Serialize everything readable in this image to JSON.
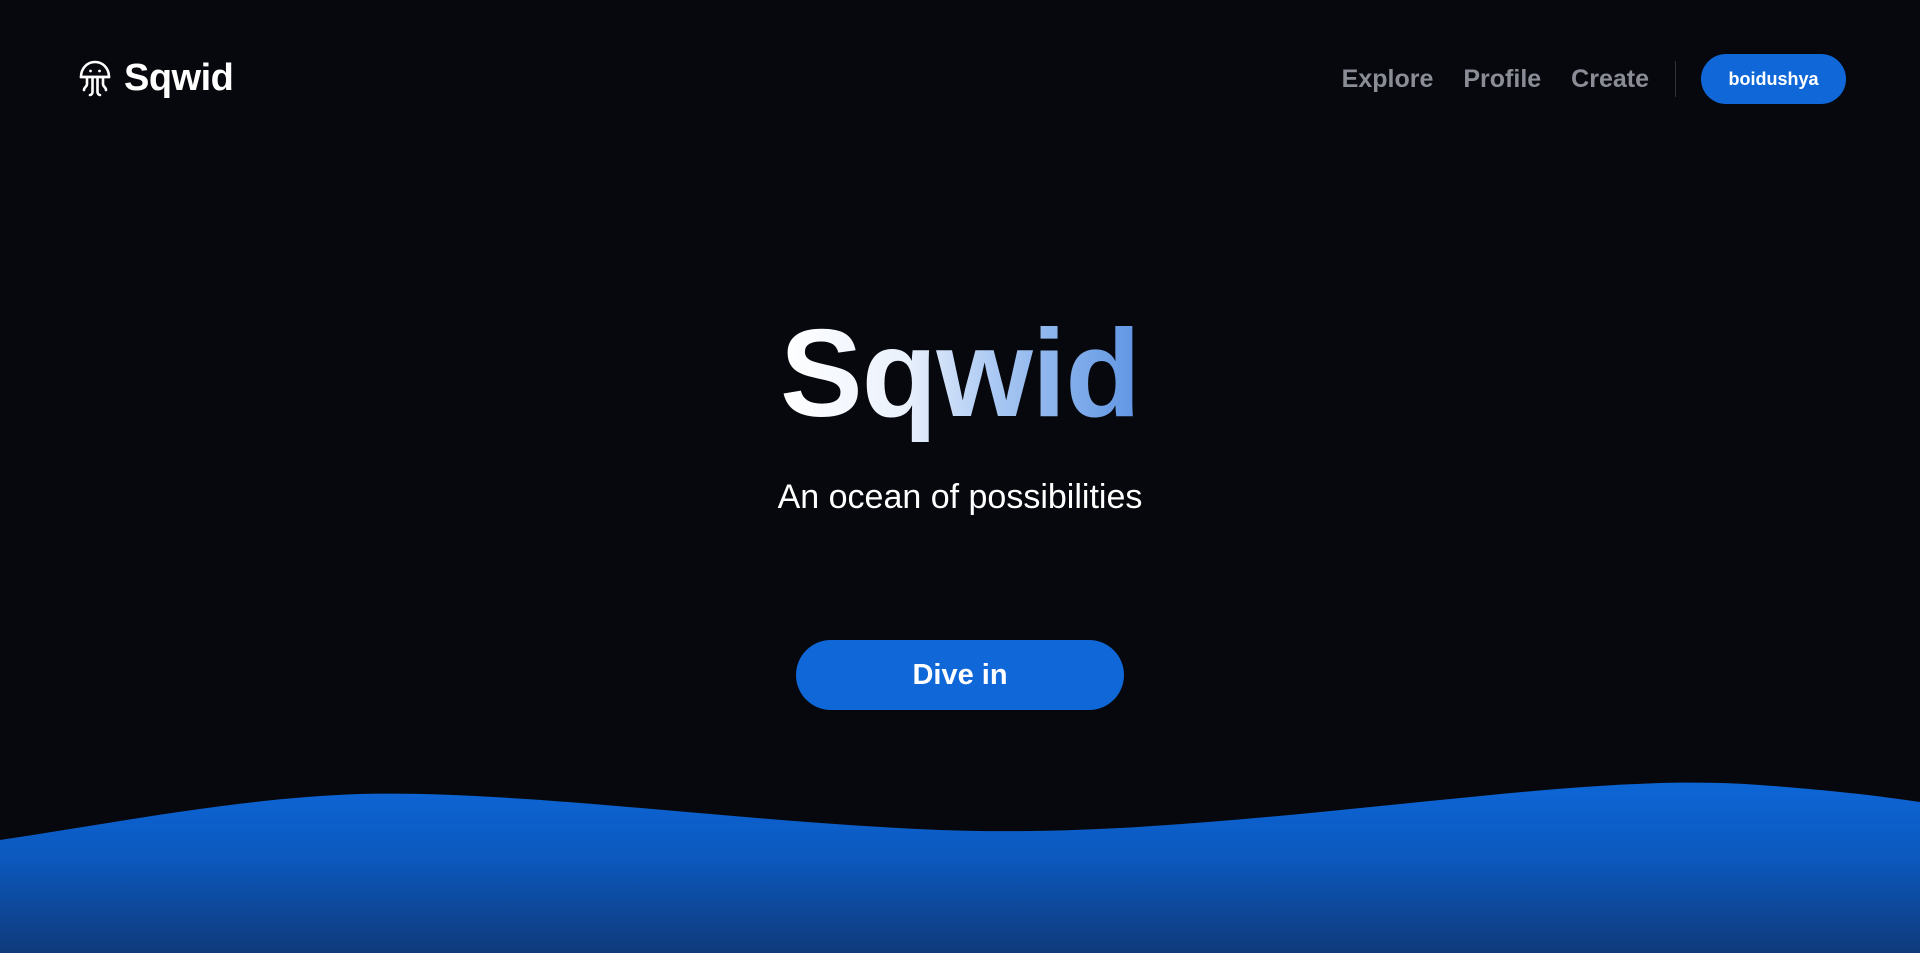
{
  "nav": {
    "brand_name": "Sqwid",
    "links": [
      {
        "label": "Explore"
      },
      {
        "label": "Profile"
      },
      {
        "label": "Create"
      }
    ],
    "account_label": "boidushya"
  },
  "hero": {
    "title": "Sqwid",
    "subtitle": "An ocean of possibilities",
    "cta_label": "Dive in"
  },
  "icons": {
    "brand": "jellyfish-icon"
  },
  "colors": {
    "background": "#07080d",
    "accent": "#0f67d8",
    "nav_link": "#8a8d96",
    "wave_top": "#0d66d6",
    "wave_bottom": "#0f3a7a"
  }
}
